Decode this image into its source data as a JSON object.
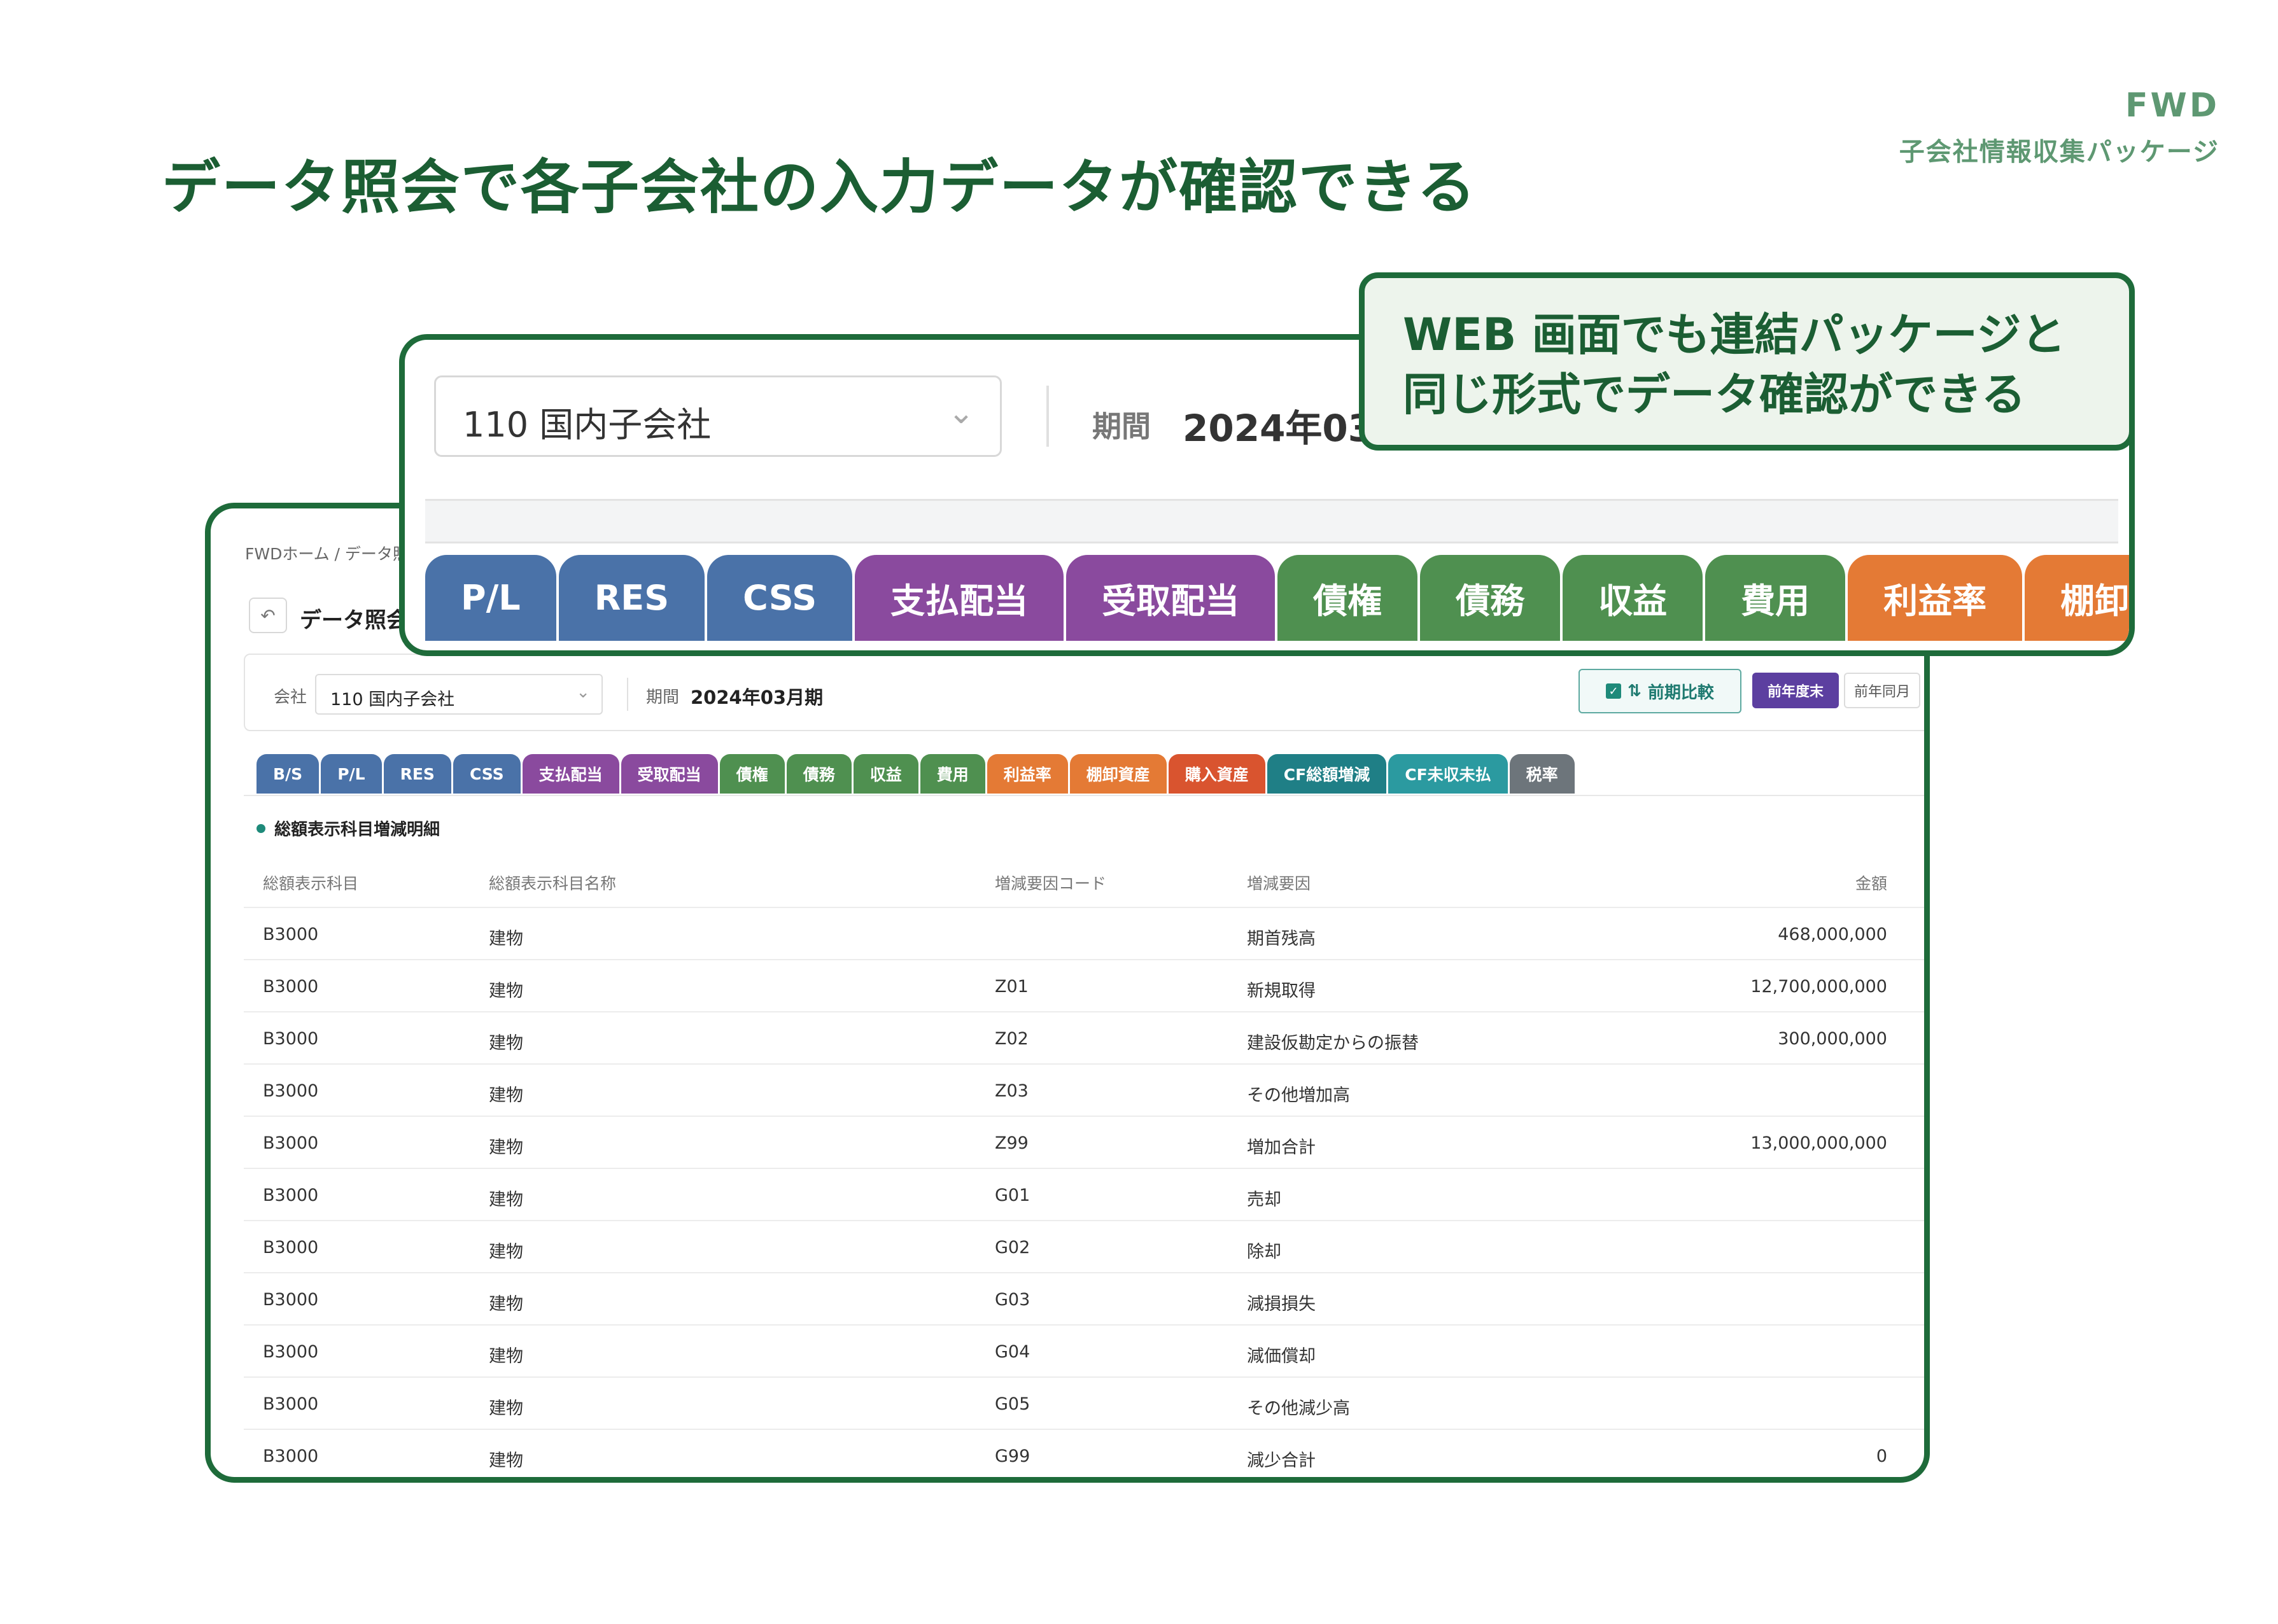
{
  "header": {
    "title": "データ照会で各子会社の入力データが確認できる",
    "brand_name": "FWD",
    "brand_sub": "子会社情報収集パッケージ"
  },
  "callout": {
    "line1": "WEB 画面でも連結パッケージと",
    "line2": "同じ形式でデータ確認ができる"
  },
  "zoom": {
    "company_value": "110 国内子会社",
    "period_label": "期間",
    "period_value": "2024年03",
    "tabs": [
      {
        "label": "P/L",
        "color": "#4a72a8"
      },
      {
        "label": "RES",
        "color": "#4a72a8"
      },
      {
        "label": "CSS",
        "color": "#4a72a8"
      },
      {
        "label": "支払配当",
        "color": "#8a4a9e"
      },
      {
        "label": "受取配当",
        "color": "#8a4a9e"
      },
      {
        "label": "債権",
        "color": "#4f9050"
      },
      {
        "label": "債務",
        "color": "#4f9050"
      },
      {
        "label": "収益",
        "color": "#4f9050"
      },
      {
        "label": "費用",
        "color": "#4f9050"
      },
      {
        "label": "利益率",
        "color": "#e47a35"
      },
      {
        "label": "棚卸資",
        "color": "#e47a35"
      }
    ]
  },
  "screen": {
    "breadcrumb": "FWDホーム / データ照",
    "back_icon": "undo-arrow",
    "title": "データ照会",
    "filters": {
      "company_label": "会社",
      "company_value": "110 国内子会社",
      "period_label": "期間",
      "period_value": "2024年03月期",
      "compare_label": "前期比較",
      "prev_year_end_label": "前年度末",
      "prev_year_month_label": "前年同月"
    },
    "tabs": [
      {
        "label": "B/S",
        "color": "#4a72a8"
      },
      {
        "label": "P/L",
        "color": "#4a72a8"
      },
      {
        "label": "RES",
        "color": "#4a72a8"
      },
      {
        "label": "CSS",
        "color": "#4a72a8"
      },
      {
        "label": "支払配当",
        "color": "#8a4a9e"
      },
      {
        "label": "受取配当",
        "color": "#8a4a9e"
      },
      {
        "label": "債権",
        "color": "#4f9050"
      },
      {
        "label": "債務",
        "color": "#4f9050"
      },
      {
        "label": "収益",
        "color": "#4f9050"
      },
      {
        "label": "費用",
        "color": "#4f9050"
      },
      {
        "label": "利益率",
        "color": "#e47a35"
      },
      {
        "label": "棚卸資産",
        "color": "#e47a35"
      },
      {
        "label": "購入資産",
        "color": "#d9542f"
      },
      {
        "label": "CF総額増減",
        "color": "#1f7f86"
      },
      {
        "label": "CF未収未払",
        "color": "#2b9aa0"
      },
      {
        "label": "税率",
        "color": "#6d757b"
      }
    ],
    "section_title": "総額表示科目増減明細",
    "table": {
      "headers": [
        "総額表示科目",
        "総額表示科目名称",
        "増減要因コード",
        "増減要因",
        "金額",
        "("
      ],
      "rows": [
        [
          "B3000",
          "建物",
          "",
          "期首残高",
          "468,000,000"
        ],
        [
          "B3000",
          "建物",
          "Z01",
          "新規取得",
          "12,700,000,000"
        ],
        [
          "B3000",
          "建物",
          "Z02",
          "建設仮勘定からの振替",
          "300,000,000"
        ],
        [
          "B3000",
          "建物",
          "Z03",
          "その他増加高",
          ""
        ],
        [
          "B3000",
          "建物",
          "Z99",
          "増加合計",
          "13,000,000,000"
        ],
        [
          "B3000",
          "建物",
          "G01",
          "売却",
          ""
        ],
        [
          "B3000",
          "建物",
          "G02",
          "除却",
          ""
        ],
        [
          "B3000",
          "建物",
          "G03",
          "減損損失",
          ""
        ],
        [
          "B3000",
          "建物",
          "G04",
          "減価償却",
          ""
        ],
        [
          "B3000",
          "建物",
          "G05",
          "その他減少高",
          ""
        ],
        [
          "B3000",
          "建物",
          "G99",
          "減少合計",
          "0"
        ]
      ]
    }
  }
}
